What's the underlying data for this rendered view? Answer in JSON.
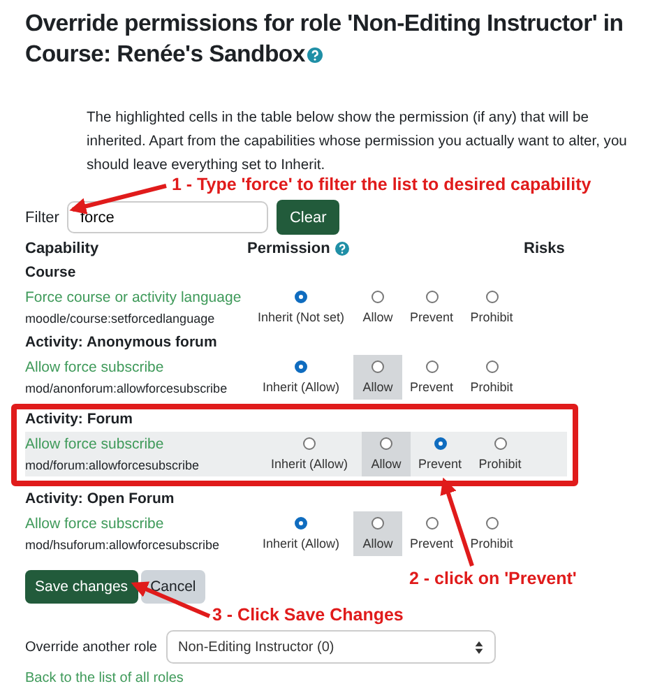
{
  "title": "Override permissions for role 'Non-Editing Instructor' in Course: Renée's Sandbox",
  "description": "The highlighted cells in the table below show the permission (if any) that will be inherited. Apart from the capabilities whose permission you actually want to alter, you should leave everything set to Inherit.",
  "filter": {
    "label": "Filter",
    "value": "force",
    "clear_button": "Clear"
  },
  "columns": [
    "Capability",
    "Permission",
    "Risks"
  ],
  "groups": [
    {
      "heading": "Course",
      "outlined": false,
      "rows": [
        {
          "name": "Force course or activity language",
          "code": "moodle/course:setforcedlanguage",
          "highlighted": false,
          "options": [
            {
              "label": "Inherit (Not set)",
              "selected": true,
              "inherited": false
            },
            {
              "label": "Allow",
              "selected": false,
              "inherited": false
            },
            {
              "label": "Prevent",
              "selected": false,
              "inherited": false
            },
            {
              "label": "Prohibit",
              "selected": false,
              "inherited": false
            }
          ]
        }
      ]
    },
    {
      "heading": "Activity: Anonymous forum",
      "outlined": false,
      "rows": [
        {
          "name": "Allow force subscribe",
          "code": "mod/anonforum:allowforcesubscribe",
          "highlighted": false,
          "options": [
            {
              "label": "Inherit (Allow)",
              "selected": true,
              "inherited": false
            },
            {
              "label": "Allow",
              "selected": false,
              "inherited": true
            },
            {
              "label": "Prevent",
              "selected": false,
              "inherited": false
            },
            {
              "label": "Prohibit",
              "selected": false,
              "inherited": false
            }
          ]
        }
      ]
    },
    {
      "heading": "Activity: Forum",
      "outlined": true,
      "rows": [
        {
          "name": "Allow force subscribe",
          "code": "mod/forum:allowforcesubscribe",
          "highlighted": true,
          "options": [
            {
              "label": "Inherit (Allow)",
              "selected": false,
              "inherited": false
            },
            {
              "label": "Allow",
              "selected": false,
              "inherited": true
            },
            {
              "label": "Prevent",
              "selected": true,
              "inherited": false
            },
            {
              "label": "Prohibit",
              "selected": false,
              "inherited": false
            }
          ]
        }
      ]
    },
    {
      "heading": "Activity: Open Forum",
      "outlined": false,
      "rows": [
        {
          "name": "Allow force subscribe",
          "code": "mod/hsuforum:allowforcesubscribe",
          "highlighted": false,
          "options": [
            {
              "label": "Inherit (Allow)",
              "selected": true,
              "inherited": false
            },
            {
              "label": "Allow",
              "selected": false,
              "inherited": true
            },
            {
              "label": "Prevent",
              "selected": false,
              "inherited": false
            },
            {
              "label": "Prohibit",
              "selected": false,
              "inherited": false
            }
          ]
        }
      ]
    }
  ],
  "buttons": [
    {
      "label": "Save changes",
      "kind": "primary"
    },
    {
      "label": "Cancel",
      "kind": "secondary"
    }
  ],
  "override": {
    "label": "Override another role",
    "value": "Non-Editing Instructor (0)"
  },
  "back_link": "Back to the list of all roles",
  "annotations": [
    "1 - Type 'force' to filter the list to desired capability",
    "2 - click on 'Prevent'",
    "3 - Click Save Changes"
  ]
}
